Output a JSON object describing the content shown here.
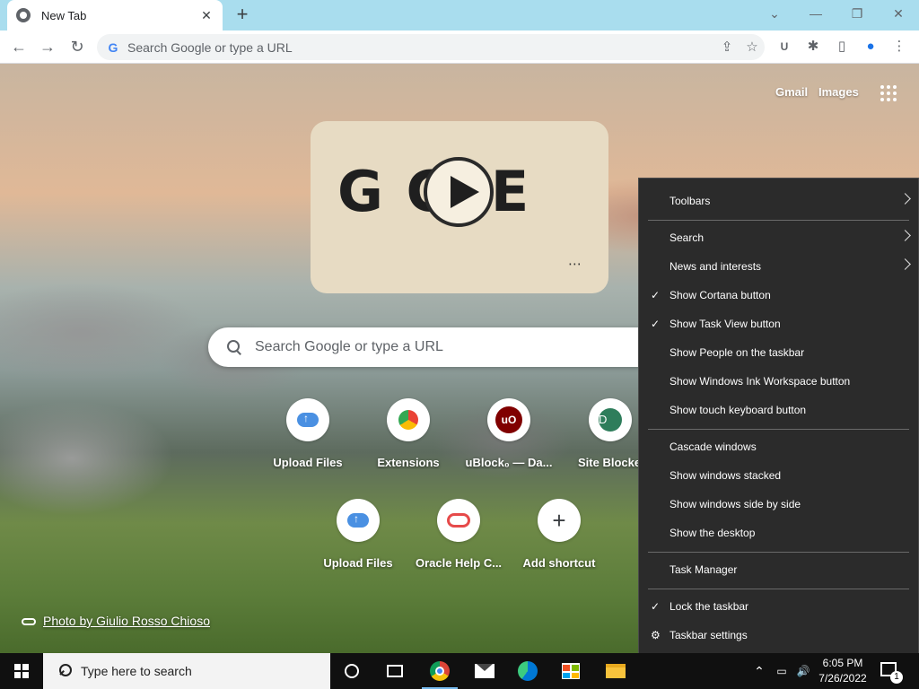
{
  "browser": {
    "tab": {
      "title": "New Tab",
      "close": "✕"
    },
    "new_tab": "+",
    "window_controls": {
      "menu": "⌄",
      "minimize": "—",
      "restore": "❐",
      "close": "✕"
    },
    "toolbar": {
      "back": "←",
      "forward": "→",
      "reload": "↻",
      "omnibox_placeholder": "Search Google or type a URL",
      "share": "⇪",
      "bookmark": "☆",
      "ublock": "U",
      "extensions": "✱",
      "sidepanel": "▯",
      "profile": "●",
      "menu": "⋮"
    }
  },
  "ntp": {
    "header_links": [
      "Gmail",
      "Images"
    ],
    "doodle": {
      "letters": "G  GLE",
      "share": "⋯"
    },
    "search_placeholder": "Search Google or type a URL",
    "shortcuts_row1": [
      {
        "label": "Upload Files",
        "icon": "cloud-upload-icon"
      },
      {
        "label": "Extensions",
        "icon": "extensions-icon"
      },
      {
        "label": "uBlock₀ — Da...",
        "icon": "ublock-icon",
        "glyph": "uO"
      },
      {
        "label": "Site Blocked",
        "icon": "letter-d-icon",
        "glyph": "D"
      }
    ],
    "shortcuts_row2": [
      {
        "label": "Upload Files",
        "icon": "cloud-upload-icon"
      },
      {
        "label": "Oracle Help C...",
        "icon": "oracle-icon"
      },
      {
        "label": "Add shortcut",
        "icon": "plus-icon",
        "glyph": "+"
      }
    ],
    "photo_credit": "Photo by Giulio Rosso Chioso"
  },
  "context_menu": {
    "items": [
      {
        "label": "Toolbars",
        "check": "",
        "submenu": true
      },
      {
        "label": "Search",
        "check": "",
        "submenu": true
      },
      {
        "label": "News and interests",
        "check": "",
        "submenu": true
      },
      {
        "label": "Show Cortana button",
        "check": "✓",
        "submenu": false
      },
      {
        "label": "Show Task View button",
        "check": "✓",
        "submenu": false
      },
      {
        "label": "Show People on the taskbar",
        "check": "",
        "submenu": false
      },
      {
        "label": "Show Windows Ink Workspace button",
        "check": "",
        "submenu": false
      },
      {
        "label": "Show touch keyboard button",
        "check": "",
        "submenu": false
      },
      {
        "label": "Cascade windows",
        "check": "",
        "submenu": false
      },
      {
        "label": "Show windows stacked",
        "check": "",
        "submenu": false
      },
      {
        "label": "Show windows side by side",
        "check": "",
        "submenu": false
      },
      {
        "label": "Show the desktop",
        "check": "",
        "submenu": false
      },
      {
        "label": "Task Manager",
        "check": "",
        "submenu": false
      },
      {
        "label": "Lock the taskbar",
        "check": "✓",
        "submenu": false
      },
      {
        "label": "Taskbar settings",
        "check": "⚙",
        "submenu": false
      }
    ]
  },
  "taskbar": {
    "search_placeholder": "Type here to search",
    "tray": {
      "chevron": "⌃",
      "network": "▭",
      "volume": "🔊"
    },
    "time": "6:05 PM",
    "date": "7/26/2022",
    "notification_count": "1"
  },
  "colors": {
    "titlebar": "#a9ddee",
    "menu_bg": "#2b2b2b",
    "taskbar_bg": "#101010",
    "accent": "#76b9ed"
  }
}
